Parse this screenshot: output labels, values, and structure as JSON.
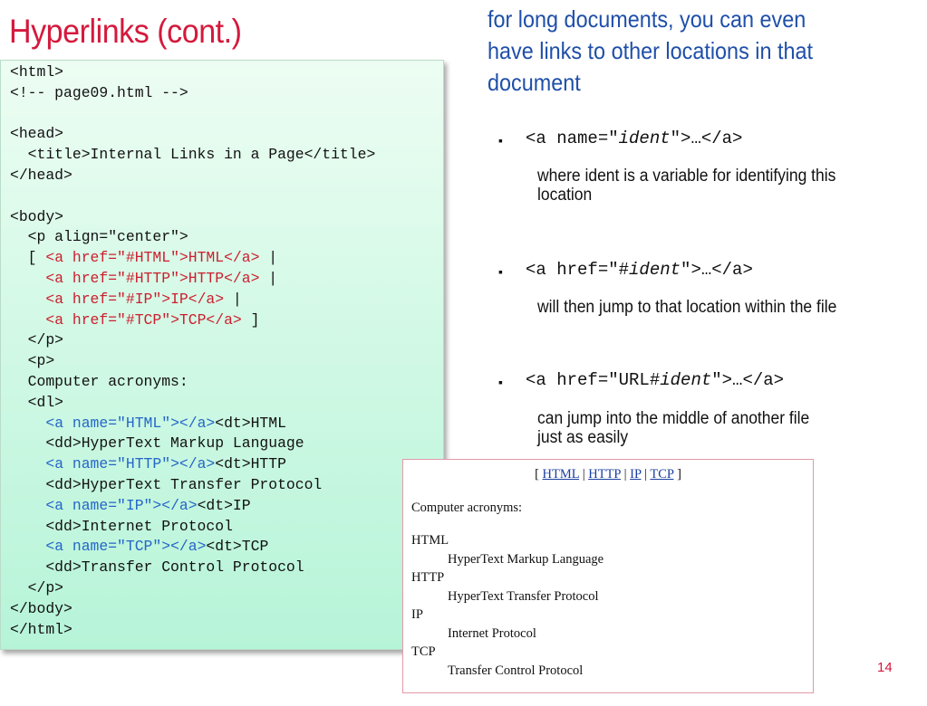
{
  "slide": {
    "title": "Hyperlinks (cont.)",
    "intro": "for long documents, you can even have links to other locations in that document",
    "page_number": "14",
    "colors": {
      "title": "#d4193c",
      "intro": "#1f4fa8",
      "code_red": "#cc1f2e",
      "code_blue": "#2566c9"
    }
  },
  "code": {
    "l1": "<html>",
    "l2": "<!-- page09.html -->",
    "l4": "<head>",
    "l5": "  <title>Internal Links in a Page</title>",
    "l6": "</head>",
    "l8": "<body>",
    "l9": "  <p align=\"center\">",
    "l10a": "  [ ",
    "l10b": "<a href=\"#HTML\">HTML</a>",
    "l10c": " |",
    "l11a": "    ",
    "l11b": "<a href=\"#HTTP\">HTTP</a>",
    "l11c": " |",
    "l12a": "    ",
    "l12b": "<a href=\"#IP\">IP</a>",
    "l12c": " |",
    "l13a": "    ",
    "l13b": "<a href=\"#TCP\">TCP</a>",
    "l13c": " ]",
    "l14": "  </p>",
    "l15": "  <p>",
    "l16": "  Computer acronyms:",
    "l17": "  <dl>",
    "l18a": "    ",
    "l18b": "<a name=\"HTML\"></a>",
    "l18c": "<dt>HTML",
    "l19": "    <dd>HyperText Markup Language",
    "l20a": "    ",
    "l20b": "<a name=\"HTTP\"></a>",
    "l20c": "<dt>HTTP",
    "l21": "    <dd>HyperText Transfer Protocol",
    "l22a": "    ",
    "l22b": "<a name=\"IP\"></a>",
    "l22c": "<dt>IP",
    "l23": "    <dd>Internet Protocol",
    "l24a": "    ",
    "l24b": "<a name=\"TCP\"></a>",
    "l24c": "<dt>TCP",
    "l25": "    <dd>Transfer Control Protocol",
    "l26": "  </p>",
    "l27": "</body>",
    "l28": "</html>"
  },
  "bullets": [
    {
      "pre": "<a name=\"",
      "var": "ident",
      "post": "\">…</a>",
      "desc": "where ident is a variable for identifying this location"
    },
    {
      "pre": "<a href=\"#",
      "var": "ident",
      "post": "\">…</a>",
      "desc": "will then jump to that location within the file"
    },
    {
      "pre": "<a href=\"URL#",
      "var": "ident",
      "post": "\">…</a>",
      "desc": "can jump into the middle of another file just as easily"
    }
  ],
  "browser": {
    "nav_open": "[ ",
    "links": [
      "HTML",
      "HTTP",
      "IP",
      "TCP"
    ],
    "sep": " | ",
    "nav_close": " ]",
    "heading": "Computer acronyms:",
    "terms": [
      {
        "dt": "HTML",
        "dd": "HyperText Markup Language"
      },
      {
        "dt": "HTTP",
        "dd": "HyperText Transfer Protocol"
      },
      {
        "dt": "IP",
        "dd": "Internet Protocol"
      },
      {
        "dt": "TCP",
        "dd": "Transfer Control Protocol"
      }
    ]
  }
}
